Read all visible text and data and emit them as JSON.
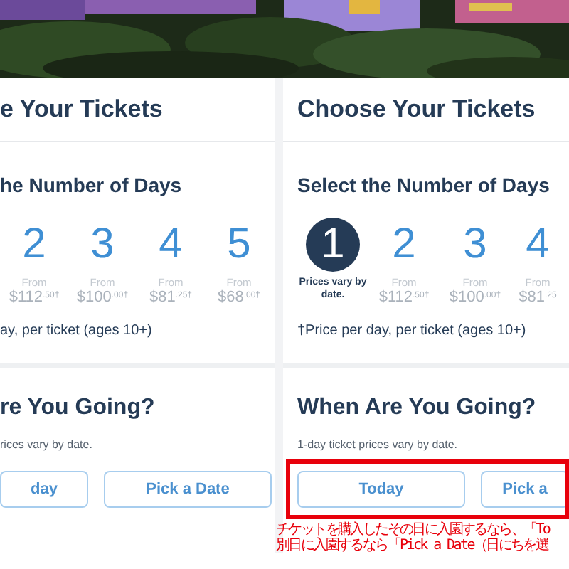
{
  "screens": [
    {
      "title": "e Your Tickets",
      "days_heading": "he Number of Days",
      "days": [
        {
          "number": "2",
          "selected": false,
          "from": "From",
          "price": "$112$^{.50†}$"
        },
        {
          "number": "3",
          "selected": false,
          "from": "From",
          "price": "$100$^{.00†}$"
        },
        {
          "number": "4",
          "selected": false,
          "from": "From",
          "price": "$81$^{.25†}$"
        },
        {
          "number": "5",
          "selected": false,
          "from": "From",
          "price": "$68$^{.00†}$"
        }
      ],
      "footnote": "ay, per ticket (ages 10+)",
      "date_heading": "re You Going?",
      "date_note": "rices vary by date.",
      "buttons": [
        "day",
        "Pick a Date"
      ]
    },
    {
      "title": "Choose Your Tickets",
      "days_heading": "Select the Number of Days",
      "highlighted": true,
      "days": [
        {
          "number": "1",
          "selected": true,
          "note": "Prices vary by date."
        },
        {
          "number": "2",
          "selected": false,
          "from": "From",
          "price": "$112$^{.50†}$"
        },
        {
          "number": "3",
          "selected": false,
          "from": "From",
          "price": "$100$^{.00†}$"
        },
        {
          "number": "4",
          "selected": false,
          "from": "From",
          "price": "$81$^{.25}$"
        }
      ],
      "footnote": "†Price per day, per ticket (ages 10+)",
      "date_heading": "When Are You Going?",
      "date_note": "1-day ticket prices vary by date.",
      "buttons": [
        "Today",
        "Pick a"
      ]
    }
  ],
  "annotation": [
    "チケットを購入したその日に入園するなら、「To",
    "別日に入園するなら「Pick a Date（日にちを選"
  ]
}
